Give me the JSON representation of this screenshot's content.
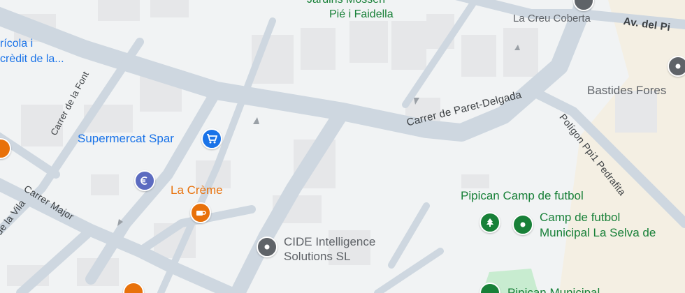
{
  "map": {
    "colors": {
      "background": "#f1f3f4",
      "road": "#ced7e0",
      "road_light": "#dde3ea",
      "building": "#e6e7e9",
      "field": "#f4efe3",
      "park": "#c8ecd0",
      "blue": "#1a73e8",
      "orange": "#e8710a",
      "green": "#188038",
      "gray": "#5f6368",
      "purple": "#5c6bc0"
    },
    "streets": {
      "carrer_de_la_font": "Carrer de la Font",
      "carrer_de_paret_delgada": "Carrer de Paret-Delgada",
      "poligon_ppi1_pedrafita": "Polígon Ppi1 Pedrafita",
      "carrer_major": "Carrer Major",
      "carrer_de_la_vila": "de la Vila",
      "av_del_pi": "Av. del Pi",
      "la_creu_coberta": "La Creu Coberta"
    },
    "places": {
      "jardins_line1": "Jardins Mossèn",
      "jardins_line2": "Pié i Faidella",
      "caixa_line1": "rícola i",
      "caixa_line2": "crèdit de la...",
      "supermercat": "Supermercat Spar",
      "la_creme": "La Crème",
      "cide_line1": "CIDE Intelligence",
      "cide_line2": "Solutions SL",
      "pipican": "Pipican Camp de futbol",
      "camp_line1": "Camp de futbol",
      "camp_line2": "Municipal La Selva de",
      "bastides": "Bastides Fores",
      "bottom_partial": "Pipican Municipal"
    },
    "icons": [
      "shopping-cart-icon",
      "euro-icon",
      "coffee-icon",
      "place-pin-icon",
      "tree-icon",
      "stadium-icon",
      "restaurant-icon"
    ]
  }
}
